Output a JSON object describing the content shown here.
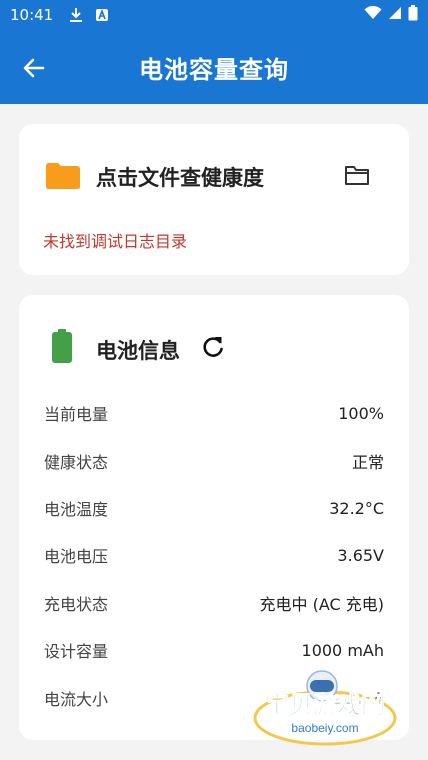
{
  "status_bar": {
    "time": "10:41"
  },
  "app_bar": {
    "title": "电池容量查询",
    "color": "#1976d2"
  },
  "health_card": {
    "title": "点击文件查健康度",
    "error_message": "未找到调试日志目录",
    "icon": "folder-icon",
    "action_icon": "folder-outline-icon"
  },
  "battery_card": {
    "title": "电池信息",
    "icon": "battery-icon",
    "action_icon": "refresh-icon",
    "rows": [
      {
        "label": "当前电量",
        "value": "100%"
      },
      {
        "label": "健康状态",
        "value": "正常"
      },
      {
        "label": "电池温度",
        "value": "32.2°C"
      },
      {
        "label": "电池电压",
        "value": "3.65V"
      },
      {
        "label": "充电状态",
        "value": "充电中 (AC 充电)"
      },
      {
        "label": "设计容量",
        "value": "1000 mAh"
      },
      {
        "label": "电流大小",
        "value": "21 mA"
      }
    ]
  },
  "watermark": {
    "text": "宝贝游戏网",
    "url_text": "baobeiy.com"
  }
}
